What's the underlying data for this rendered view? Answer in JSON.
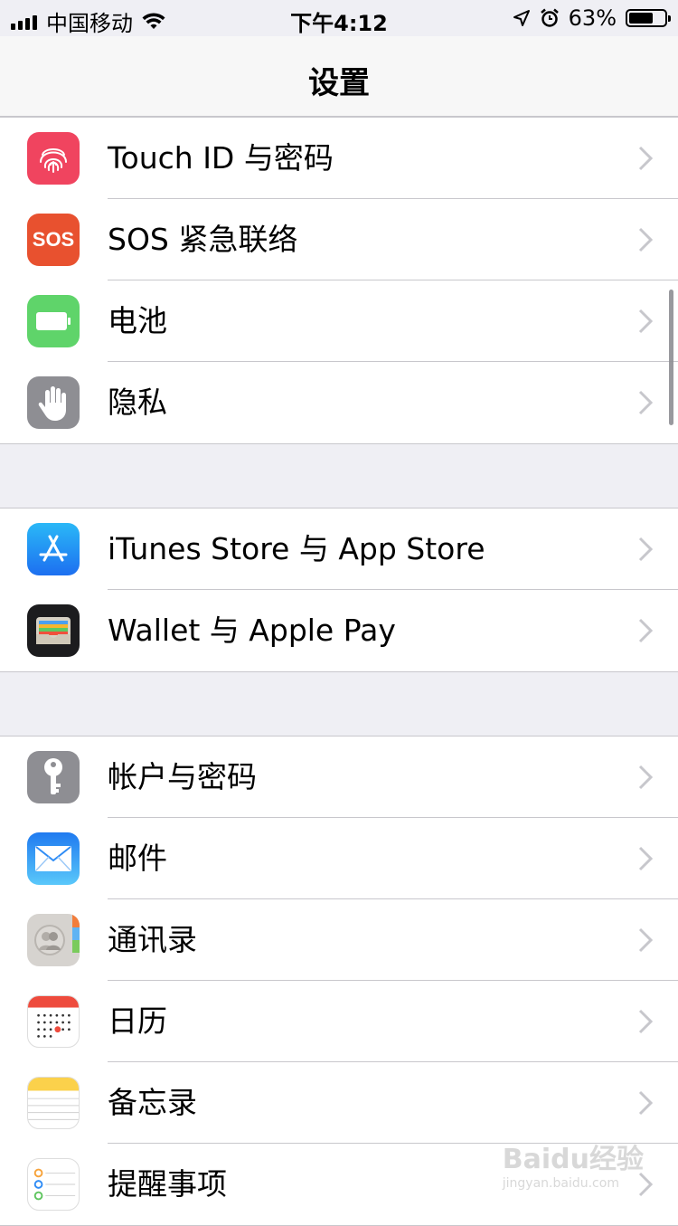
{
  "status_bar": {
    "carrier": "中国移动",
    "time": "下午4:12",
    "battery_percent": "63%",
    "battery_level": 0.63,
    "icons": [
      "signal-icon",
      "wifi-icon",
      "location-icon",
      "alarm-icon",
      "battery-icon"
    ]
  },
  "nav": {
    "title": "设置"
  },
  "groups": [
    {
      "items": [
        {
          "label": "Touch ID 与密码",
          "icon": "fingerprint-icon",
          "color": "#f0445f"
        },
        {
          "label": "SOS 紧急联络",
          "icon": "sos-icon",
          "color": "#e8512f",
          "icon_text": "SOS"
        },
        {
          "label": "电池",
          "icon": "battery-icon",
          "color": "#5fd46a"
        },
        {
          "label": "隐私",
          "icon": "hand-icon",
          "color": "#8e8e93"
        }
      ]
    },
    {
      "items": [
        {
          "label": "iTunes Store 与 App Store",
          "icon": "app-store-icon",
          "color": "#1d8ef5"
        },
        {
          "label": "Wallet 与 Apple Pay",
          "icon": "wallet-icon",
          "color": "#1c1c1e"
        }
      ]
    },
    {
      "items": [
        {
          "label": "帐户与密码",
          "icon": "key-icon",
          "color": "#8e8e93"
        },
        {
          "label": "邮件",
          "icon": "mail-icon",
          "color": "#2f8cf5"
        },
        {
          "label": "通讯录",
          "icon": "contacts-icon",
          "color": "#cfcdca"
        },
        {
          "label": "日历",
          "icon": "calendar-icon",
          "color": "#ffffff"
        },
        {
          "label": "备忘录",
          "icon": "notes-icon",
          "color": "#ffffff"
        },
        {
          "label": "提醒事项",
          "icon": "reminders-icon",
          "color": "#ffffff"
        }
      ]
    }
  ],
  "watermark": {
    "text": "Baidu经验",
    "subtext": "jingyan.baidu.com"
  }
}
